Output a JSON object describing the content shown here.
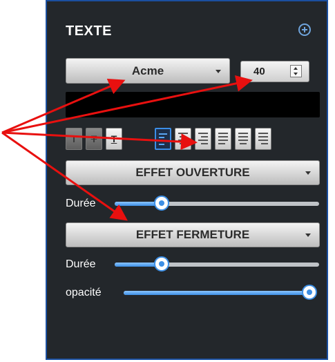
{
  "panel": {
    "title": "TEXTE",
    "add_icon": "plus-circle-icon",
    "font_select": {
      "value": "Acme"
    },
    "font_size": {
      "value": "40"
    },
    "text_input": {
      "value": ""
    },
    "format_tools": [
      {
        "kind": "text-style",
        "glyph": "T",
        "style": "plain",
        "icon": "text-bold-icon"
      },
      {
        "kind": "text-style",
        "glyph": "T",
        "style": "strike",
        "icon": "text-strike-icon"
      },
      {
        "kind": "text-style",
        "glyph": "T",
        "style": "underline",
        "icon": "text-underline-icon"
      },
      {
        "kind": "align",
        "icon": "align-left-icon",
        "active": true
      },
      {
        "kind": "align",
        "icon": "align-center-icon"
      },
      {
        "kind": "align",
        "icon": "align-right-icon"
      },
      {
        "kind": "align",
        "icon": "justify-left-icon"
      },
      {
        "kind": "align",
        "icon": "justify-center-icon"
      },
      {
        "kind": "align",
        "icon": "justify-right-icon"
      }
    ],
    "effect_open": {
      "label": "EFFET OUVERTURE"
    },
    "duration_open": {
      "label": "Durée",
      "value_fraction": 0.23
    },
    "effect_close": {
      "label": "EFFET FERMETURE"
    },
    "duration_close": {
      "label": "Durée",
      "value_fraction": 0.23
    },
    "opacity": {
      "label": "opacité",
      "value_fraction": 1.0
    }
  },
  "colors": {
    "panel_bg": "#23272b",
    "panel_border": "#1a4fa0",
    "accent": "#3d8fe5",
    "annotation_arrow": "#e8100f"
  }
}
